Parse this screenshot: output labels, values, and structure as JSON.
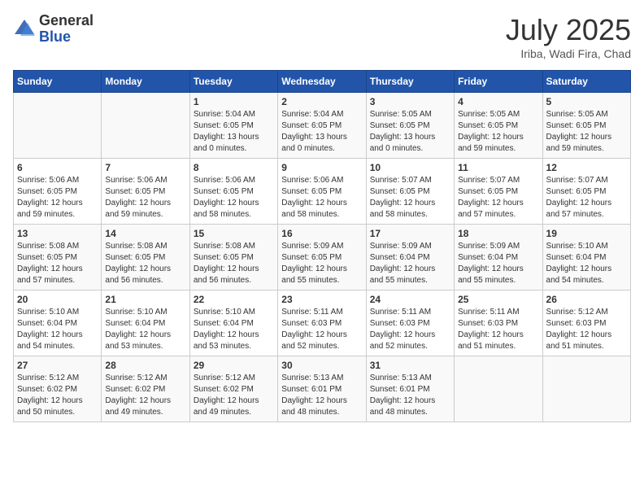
{
  "logo": {
    "general": "General",
    "blue": "Blue"
  },
  "title": "July 2025",
  "location": "Iriba, Wadi Fira, Chad",
  "days_header": [
    "Sunday",
    "Monday",
    "Tuesday",
    "Wednesday",
    "Thursday",
    "Friday",
    "Saturday"
  ],
  "weeks": [
    [
      {
        "day": "",
        "lines": []
      },
      {
        "day": "",
        "lines": []
      },
      {
        "day": "1",
        "lines": [
          "Sunrise: 5:04 AM",
          "Sunset: 6:05 PM",
          "Daylight: 13 hours",
          "and 0 minutes."
        ]
      },
      {
        "day": "2",
        "lines": [
          "Sunrise: 5:04 AM",
          "Sunset: 6:05 PM",
          "Daylight: 13 hours",
          "and 0 minutes."
        ]
      },
      {
        "day": "3",
        "lines": [
          "Sunrise: 5:05 AM",
          "Sunset: 6:05 PM",
          "Daylight: 13 hours",
          "and 0 minutes."
        ]
      },
      {
        "day": "4",
        "lines": [
          "Sunrise: 5:05 AM",
          "Sunset: 6:05 PM",
          "Daylight: 12 hours",
          "and 59 minutes."
        ]
      },
      {
        "day": "5",
        "lines": [
          "Sunrise: 5:05 AM",
          "Sunset: 6:05 PM",
          "Daylight: 12 hours",
          "and 59 minutes."
        ]
      }
    ],
    [
      {
        "day": "6",
        "lines": [
          "Sunrise: 5:06 AM",
          "Sunset: 6:05 PM",
          "Daylight: 12 hours",
          "and 59 minutes."
        ]
      },
      {
        "day": "7",
        "lines": [
          "Sunrise: 5:06 AM",
          "Sunset: 6:05 PM",
          "Daylight: 12 hours",
          "and 59 minutes."
        ]
      },
      {
        "day": "8",
        "lines": [
          "Sunrise: 5:06 AM",
          "Sunset: 6:05 PM",
          "Daylight: 12 hours",
          "and 58 minutes."
        ]
      },
      {
        "day": "9",
        "lines": [
          "Sunrise: 5:06 AM",
          "Sunset: 6:05 PM",
          "Daylight: 12 hours",
          "and 58 minutes."
        ]
      },
      {
        "day": "10",
        "lines": [
          "Sunrise: 5:07 AM",
          "Sunset: 6:05 PM",
          "Daylight: 12 hours",
          "and 58 minutes."
        ]
      },
      {
        "day": "11",
        "lines": [
          "Sunrise: 5:07 AM",
          "Sunset: 6:05 PM",
          "Daylight: 12 hours",
          "and 57 minutes."
        ]
      },
      {
        "day": "12",
        "lines": [
          "Sunrise: 5:07 AM",
          "Sunset: 6:05 PM",
          "Daylight: 12 hours",
          "and 57 minutes."
        ]
      }
    ],
    [
      {
        "day": "13",
        "lines": [
          "Sunrise: 5:08 AM",
          "Sunset: 6:05 PM",
          "Daylight: 12 hours",
          "and 57 minutes."
        ]
      },
      {
        "day": "14",
        "lines": [
          "Sunrise: 5:08 AM",
          "Sunset: 6:05 PM",
          "Daylight: 12 hours",
          "and 56 minutes."
        ]
      },
      {
        "day": "15",
        "lines": [
          "Sunrise: 5:08 AM",
          "Sunset: 6:05 PM",
          "Daylight: 12 hours",
          "and 56 minutes."
        ]
      },
      {
        "day": "16",
        "lines": [
          "Sunrise: 5:09 AM",
          "Sunset: 6:05 PM",
          "Daylight: 12 hours",
          "and 55 minutes."
        ]
      },
      {
        "day": "17",
        "lines": [
          "Sunrise: 5:09 AM",
          "Sunset: 6:04 PM",
          "Daylight: 12 hours",
          "and 55 minutes."
        ]
      },
      {
        "day": "18",
        "lines": [
          "Sunrise: 5:09 AM",
          "Sunset: 6:04 PM",
          "Daylight: 12 hours",
          "and 55 minutes."
        ]
      },
      {
        "day": "19",
        "lines": [
          "Sunrise: 5:10 AM",
          "Sunset: 6:04 PM",
          "Daylight: 12 hours",
          "and 54 minutes."
        ]
      }
    ],
    [
      {
        "day": "20",
        "lines": [
          "Sunrise: 5:10 AM",
          "Sunset: 6:04 PM",
          "Daylight: 12 hours",
          "and 54 minutes."
        ]
      },
      {
        "day": "21",
        "lines": [
          "Sunrise: 5:10 AM",
          "Sunset: 6:04 PM",
          "Daylight: 12 hours",
          "and 53 minutes."
        ]
      },
      {
        "day": "22",
        "lines": [
          "Sunrise: 5:10 AM",
          "Sunset: 6:04 PM",
          "Daylight: 12 hours",
          "and 53 minutes."
        ]
      },
      {
        "day": "23",
        "lines": [
          "Sunrise: 5:11 AM",
          "Sunset: 6:03 PM",
          "Daylight: 12 hours",
          "and 52 minutes."
        ]
      },
      {
        "day": "24",
        "lines": [
          "Sunrise: 5:11 AM",
          "Sunset: 6:03 PM",
          "Daylight: 12 hours",
          "and 52 minutes."
        ]
      },
      {
        "day": "25",
        "lines": [
          "Sunrise: 5:11 AM",
          "Sunset: 6:03 PM",
          "Daylight: 12 hours",
          "and 51 minutes."
        ]
      },
      {
        "day": "26",
        "lines": [
          "Sunrise: 5:12 AM",
          "Sunset: 6:03 PM",
          "Daylight: 12 hours",
          "and 51 minutes."
        ]
      }
    ],
    [
      {
        "day": "27",
        "lines": [
          "Sunrise: 5:12 AM",
          "Sunset: 6:02 PM",
          "Daylight: 12 hours",
          "and 50 minutes."
        ]
      },
      {
        "day": "28",
        "lines": [
          "Sunrise: 5:12 AM",
          "Sunset: 6:02 PM",
          "Daylight: 12 hours",
          "and 49 minutes."
        ]
      },
      {
        "day": "29",
        "lines": [
          "Sunrise: 5:12 AM",
          "Sunset: 6:02 PM",
          "Daylight: 12 hours",
          "and 49 minutes."
        ]
      },
      {
        "day": "30",
        "lines": [
          "Sunrise: 5:13 AM",
          "Sunset: 6:01 PM",
          "Daylight: 12 hours",
          "and 48 minutes."
        ]
      },
      {
        "day": "31",
        "lines": [
          "Sunrise: 5:13 AM",
          "Sunset: 6:01 PM",
          "Daylight: 12 hours",
          "and 48 minutes."
        ]
      },
      {
        "day": "",
        "lines": []
      },
      {
        "day": "",
        "lines": []
      }
    ]
  ]
}
